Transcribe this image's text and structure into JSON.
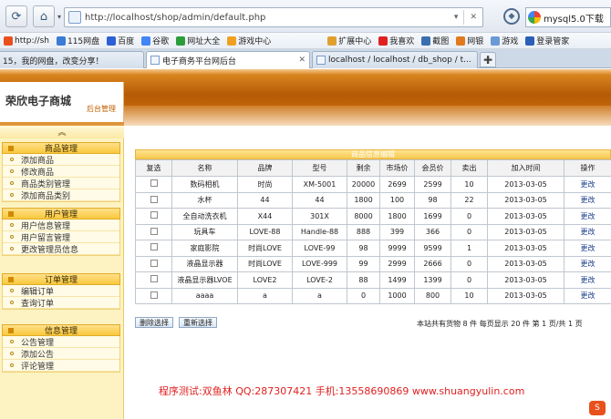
{
  "browser": {
    "url": "http://localhost/shop/admin/default.php",
    "search_text": "mysql5.0下载",
    "favorites": [
      "http://sh",
      "115网盘",
      "百度",
      "谷歌",
      "网址大全",
      "游戏中心",
      "扩展中心",
      "我喜欢",
      "截图",
      "网银",
      "游戏",
      "登录管家"
    ],
    "tabs": [
      "15，我的网盘，改变分享！",
      "电子商务平台网后台",
      "localhost / localhost / db_shop / t..."
    ],
    "active_tab": 1
  },
  "admin": {
    "logo_name": "荣欣电子商城",
    "logo_sub": "后台管理",
    "collapse_symbol": "︽",
    "groups": [
      {
        "title": "商品管理",
        "items": [
          "添加商品",
          "修改商品",
          "商品类别管理",
          "添加商品类别"
        ]
      },
      {
        "title": "用户管理",
        "items": [
          "用户信息管理",
          "用户留言管理",
          "更改管理员信息"
        ]
      },
      {
        "title": "订单管理",
        "items": [
          "编辑订单",
          "查询订单"
        ]
      },
      {
        "title": "信息管理",
        "items": [
          "公告管理",
          "添加公告",
          "评论管理"
        ]
      }
    ]
  },
  "table": {
    "caption": "商品信息编辑",
    "headers": [
      "复选",
      "名称",
      "品牌",
      "型号",
      "剩余",
      "市场价",
      "会员价",
      "卖出",
      "加入时间",
      "操作"
    ],
    "rows": [
      [
        "数码相机",
        "时尚",
        "XM-5001",
        "20000",
        "2699",
        "2599",
        "10",
        "2013-03-05",
        "更改"
      ],
      [
        "水杯",
        "44",
        "44",
        "1800",
        "100",
        "98",
        "22",
        "2013-03-05",
        "更改"
      ],
      [
        "全自动洗衣机",
        "X44",
        "301X",
        "8000",
        "1800",
        "1699",
        "0",
        "2013-03-05",
        "更改"
      ],
      [
        "玩具车",
        "LOVE-88",
        "Handle-88",
        "888",
        "399",
        "366",
        "0",
        "2013-03-05",
        "更改"
      ],
      [
        "家庭影院",
        "时尚LOVE",
        "LOVE-99",
        "98",
        "9999",
        "9599",
        "1",
        "2013-03-05",
        "更改"
      ],
      [
        "液晶显示器",
        "时尚LOVE",
        "LOVE-999",
        "99",
        "2999",
        "2666",
        "0",
        "2013-03-05",
        "更改"
      ],
      [
        "液晶显示器LVOE",
        "LOVE2",
        "LOVE-2",
        "88",
        "1499",
        "1399",
        "0",
        "2013-03-05",
        "更改"
      ],
      [
        "aaaa",
        "a",
        "a",
        "0",
        "1000",
        "800",
        "10",
        "2013-03-05",
        "更改"
      ]
    ]
  },
  "actions": {
    "delete_label": "删除选择",
    "reselect_label": "重新选择"
  },
  "pager_text": "本站共有货物 8 件 每页显示 20 件 第 1 页/共 1 页",
  "credits": "程序测试:双鱼林 QQ:287307421 手机:13558690869 www.shuangyulin.com",
  "colors": {
    "banner": "#b55a05",
    "sidebar": "#fdf3c2",
    "credits": "#e02020"
  }
}
